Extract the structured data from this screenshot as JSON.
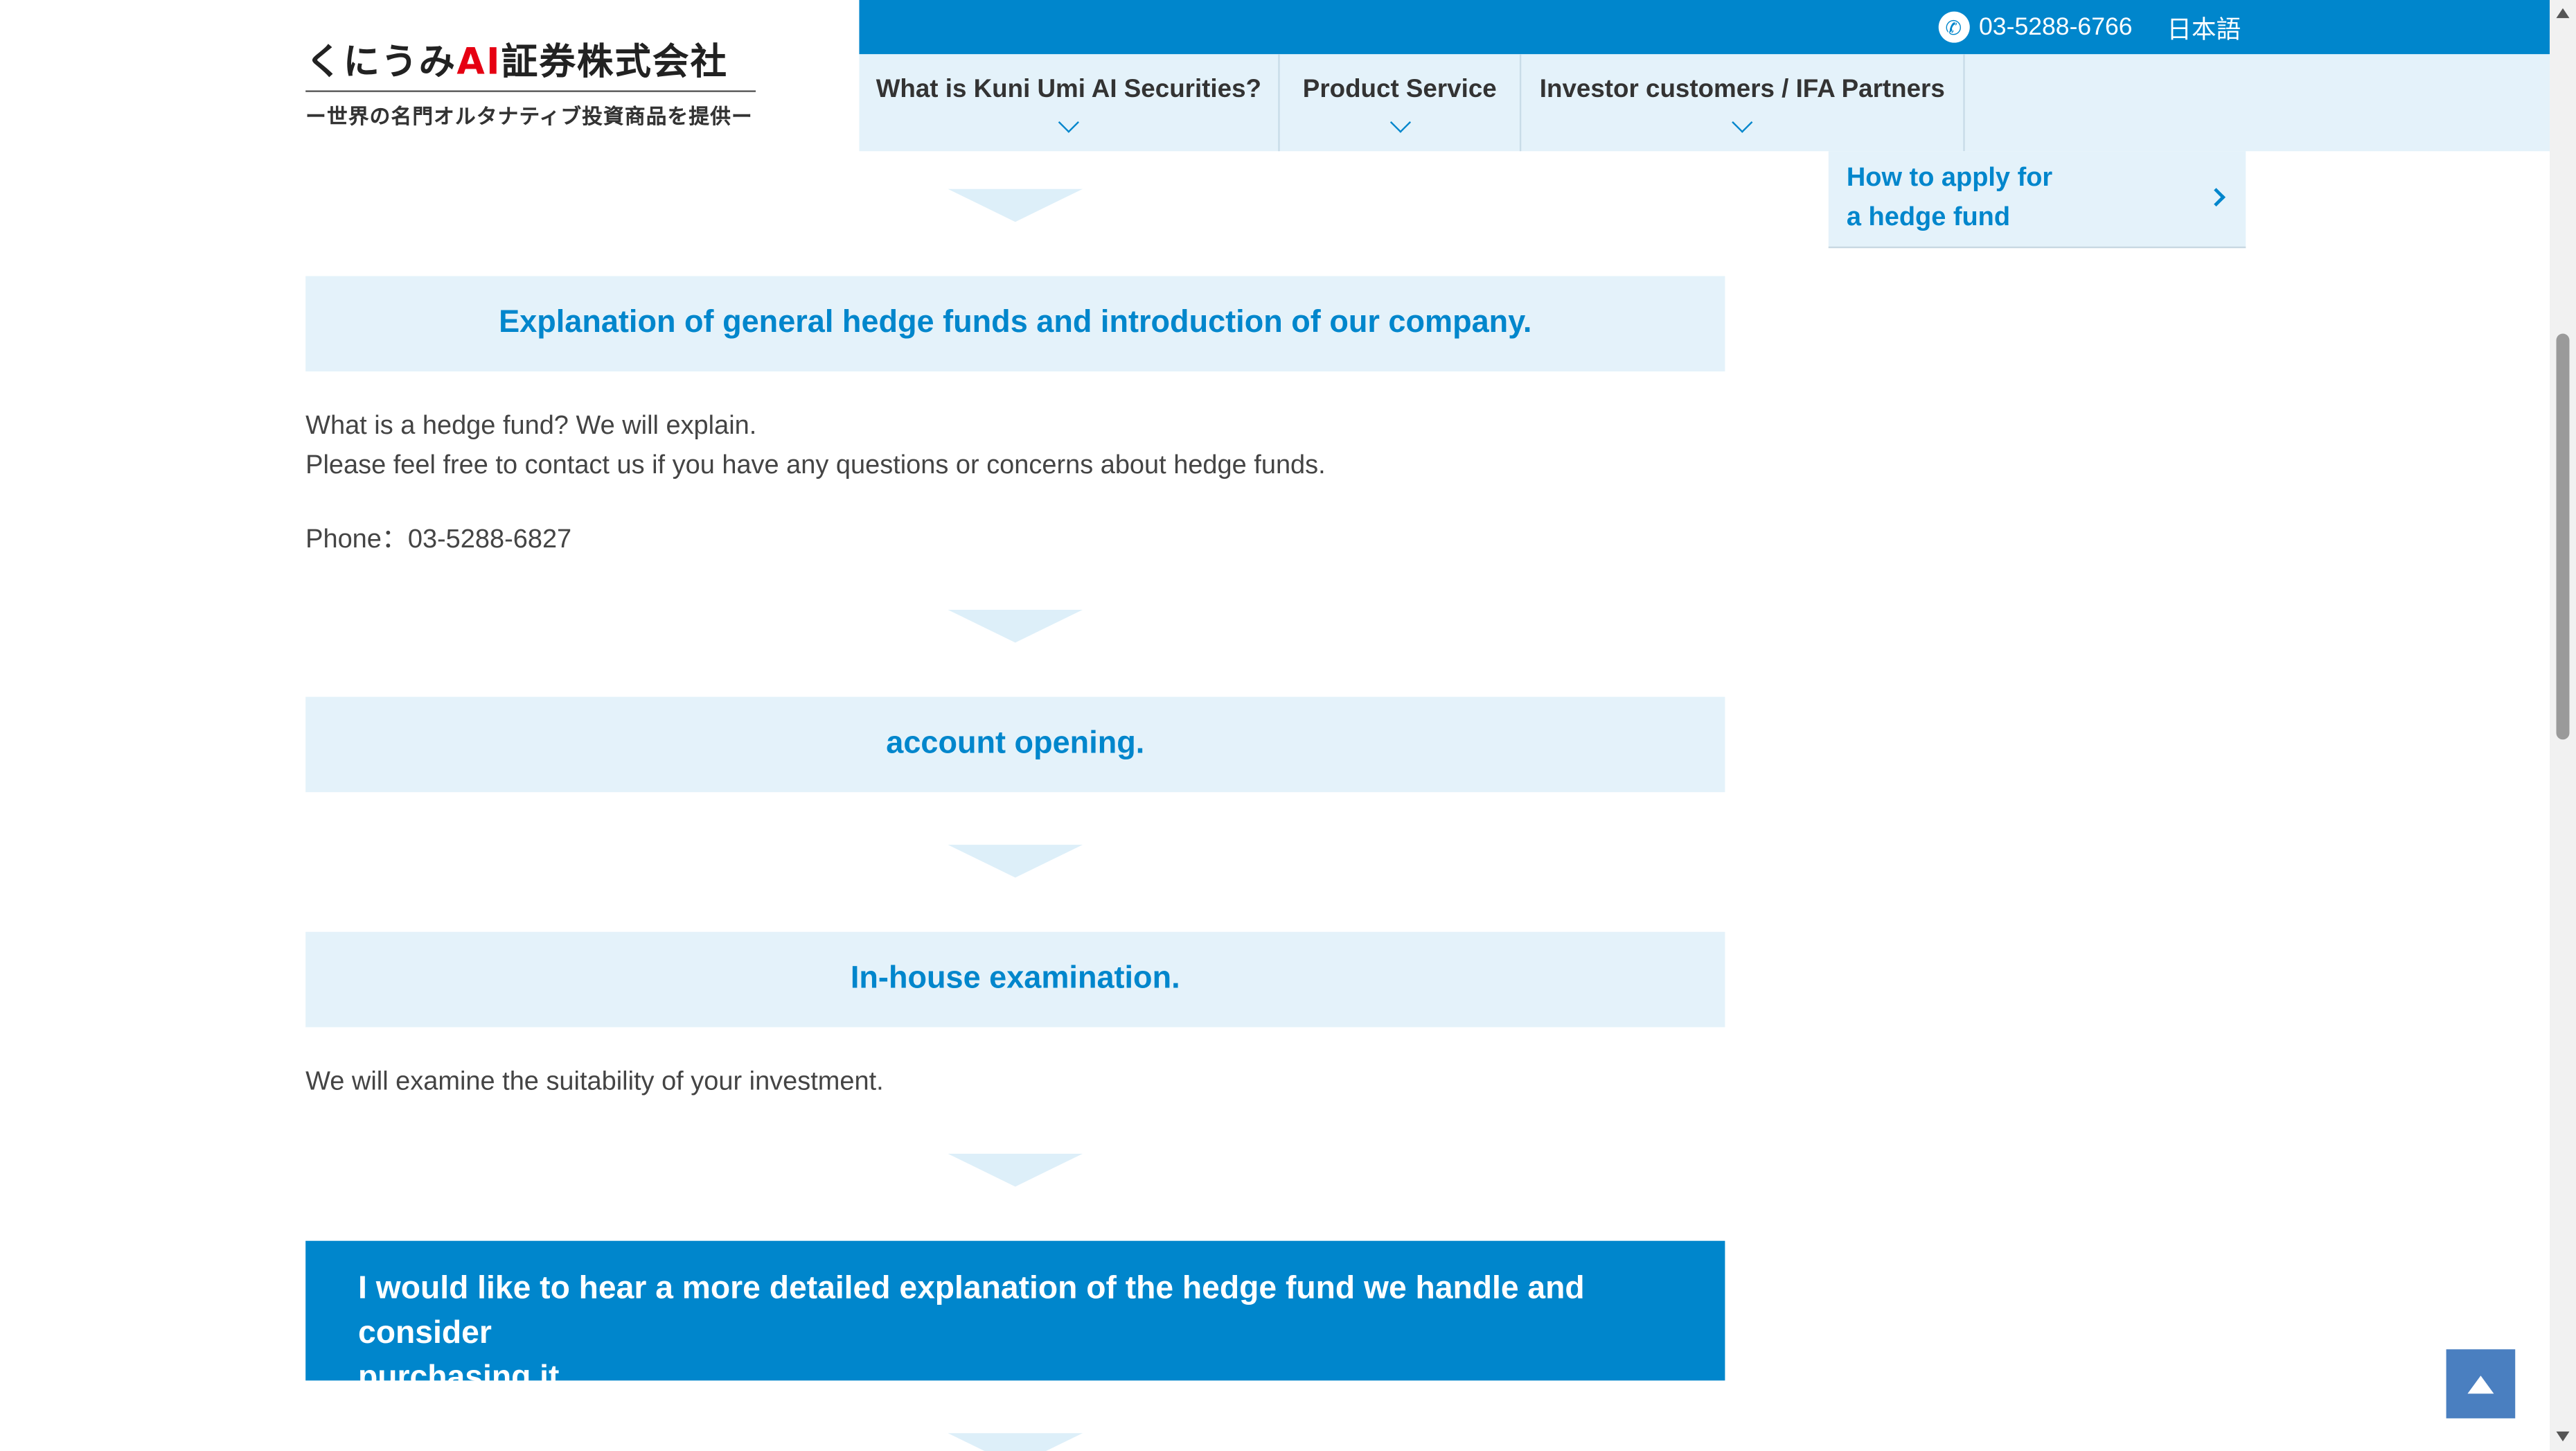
{
  "logo": {
    "main_prefix": "くにうみ",
    "main_ai": "AI",
    "main_suffix": "証券株式会社",
    "tagline": "ー世界の名門オルタナティブ投資商品を提供ー"
  },
  "topbar": {
    "phone": "03-5288-6766",
    "phone_icon": "phone-icon",
    "language": "日本語"
  },
  "nav": {
    "items": [
      {
        "label": "What is Kuni Umi AI Securities?"
      },
      {
        "label": "Product Service"
      },
      {
        "label": "Investor customers / IFA Partners"
      }
    ]
  },
  "sidebar": {
    "link_line1": "How to apply for",
    "link_line2": "a hedge fund"
  },
  "steps": [
    {
      "title": "Explanation of general hedge funds and introduction of our company.",
      "line1": "What is a hedge fund? We will explain.",
      "line2": "Please feel free to contact us if you have any questions or concerns about hedge funds.",
      "phone": "Phone：03-5288-6827"
    },
    {
      "title": "account opening."
    },
    {
      "title": "In-house examination.",
      "line1": "We will examine the suitability of your investment."
    }
  ],
  "cta": {
    "line1": "I would like to hear a more detailed explanation of the hedge fund we handle and consider",
    "line2": "purchasing it."
  },
  "colors": {
    "brand_blue": "#0086cc",
    "light_blue": "#e4f2fa",
    "logo_red": "#e60012",
    "to_top": "#4a7fc0"
  }
}
